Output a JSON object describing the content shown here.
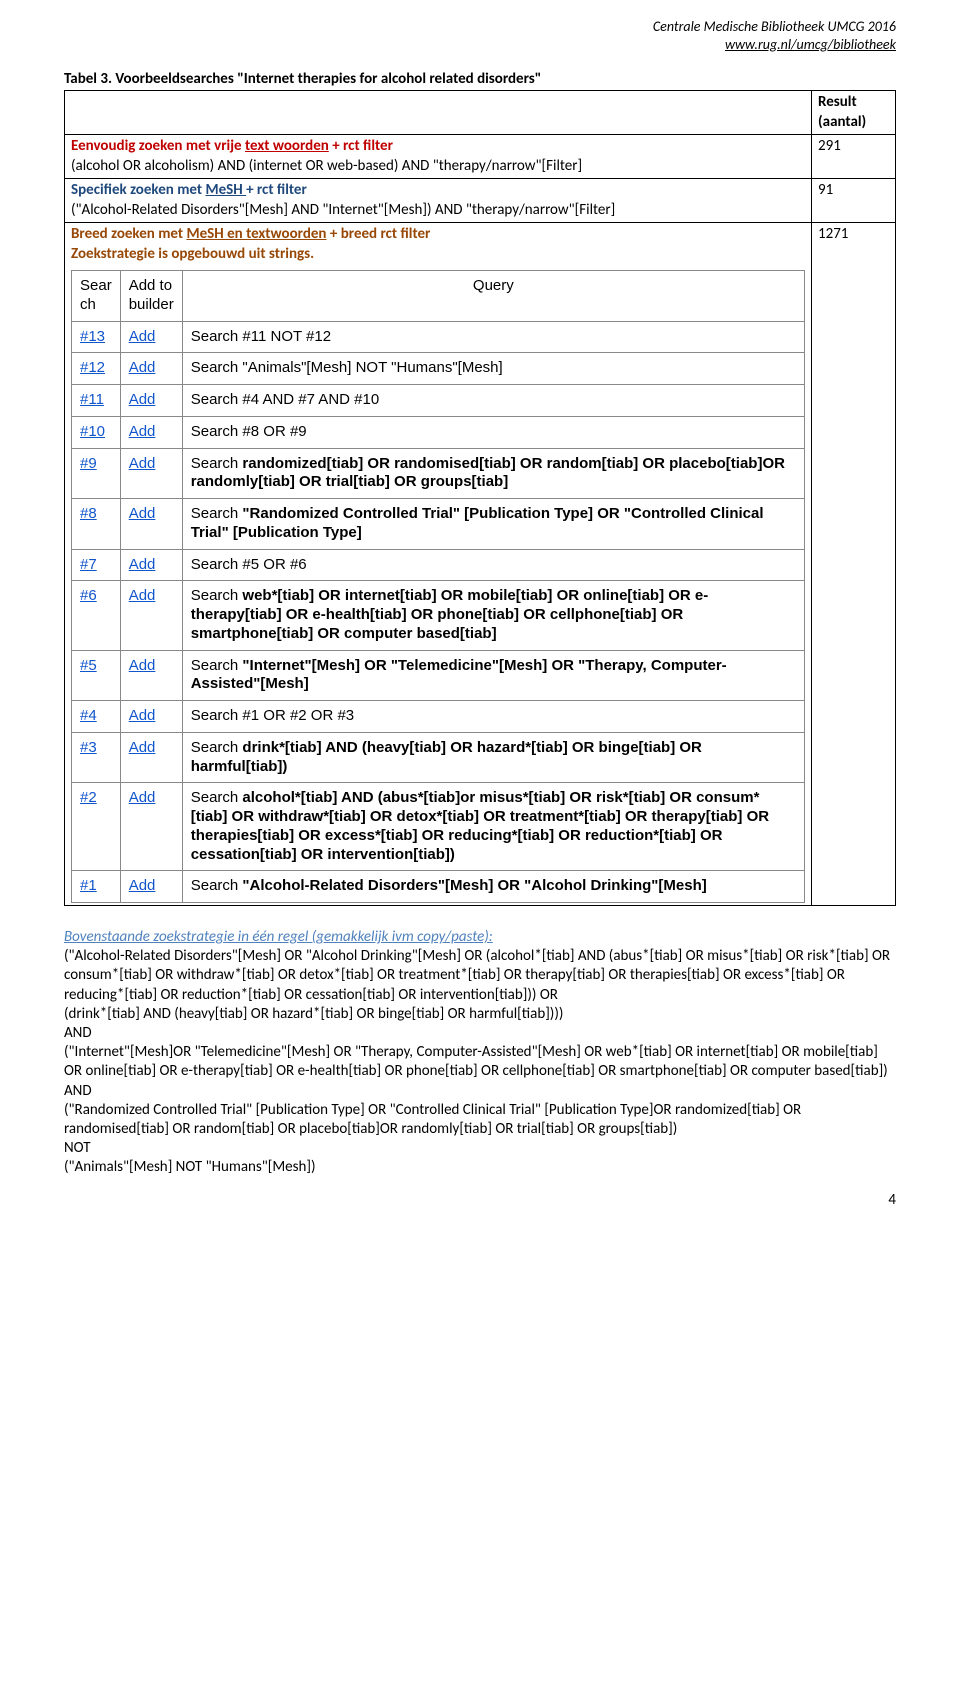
{
  "header": {
    "org": "Centrale Medische Bibliotheek UMCG 2016",
    "url": "www.rug.nl/umcg/bibliotheek"
  },
  "caption": "Tabel 3. Voorbeeldsearches \"Internet therapies  for alcohol related disorders\"",
  "thead": {
    "empty": "",
    "result": "Result (aantal)"
  },
  "rows": [
    {
      "title_plain": "Eenvoudig zoeken met vrije ",
      "title_ul": "text woorden",
      "title_rest": " +  rct filter",
      "body": "(alcohol OR alcoholism) AND (internet OR web-based) AND \"therapy/narrow\"[Filter]",
      "result": "291"
    },
    {
      "title_plain": "Specifiek zoeken met ",
      "title_ul": "MeSH ",
      "title_rest": " + rct filter",
      "body": "(\"Alcohol-Related Disorders\"[Mesh] AND \"Internet\"[Mesh]) AND \"therapy/narrow\"[Filter]",
      "result": "91"
    },
    {
      "title_plain": "Breed zoeken met ",
      "title_ul": "MeSH en textwoorden",
      "title_rest": " + breed rct filter",
      "subtitle": "Zoekstrategie is opgebouwd uit strings.",
      "result": "1271"
    }
  ],
  "inner_head": {
    "search": "Sear ch",
    "add": "Add to builder",
    "query": "Query"
  },
  "search_prefix": "Search ",
  "queries": [
    {
      "id": "#13",
      "add": "Add",
      "q": "#11 NOT #12"
    },
    {
      "id": "#12",
      "add": "Add",
      "q": "\"Animals\"[Mesh] NOT \"Humans\"[Mesh]"
    },
    {
      "id": "#11",
      "add": "Add",
      "q": "#4 AND #7 AND #10"
    },
    {
      "id": "#10",
      "add": "Add",
      "q": "#8 OR #9"
    },
    {
      "id": "#9",
      "add": "Add",
      "bold": "randomized[tiab] OR randomised[tiab] OR random[tiab] OR placebo[tiab]OR randomly[tiab] OR trial[tiab] OR groups[tiab]"
    },
    {
      "id": "#8",
      "add": "Add",
      "bold": "\"Randomized Controlled Trial\" [Publication Type] OR \"Controlled Clinical Trial\" [Publication Type]"
    },
    {
      "id": "#7",
      "add": "Add",
      "q": "#5 OR #6"
    },
    {
      "id": "#6",
      "add": "Add",
      "bold": "web*[tiab] OR internet[tiab] OR mobile[tiab] OR online[tiab] OR e-therapy[tiab] OR e-health[tiab] OR phone[tiab] OR cellphone[tiab] OR smartphone[tiab] OR computer based[tiab]"
    },
    {
      "id": "#5",
      "add": "Add",
      "bold": "\"Internet\"[Mesh] OR \"Telemedicine\"[Mesh] OR \"Therapy, Computer-Assisted\"[Mesh]"
    },
    {
      "id": "#4",
      "add": "Add",
      "q": "#1 OR #2 OR #3"
    },
    {
      "id": "#3",
      "add": "Add",
      "bold": "drink*[tiab] AND (heavy[tiab] OR hazard*[tiab] OR binge[tiab] OR harmful[tiab])"
    },
    {
      "id": "#2",
      "add": "Add",
      "bold": "alcohol*[tiab] AND (abus*[tiab]or misus*[tiab] OR risk*[tiab] OR consum*[tiab] OR withdraw*[tiab] OR detox*[tiab] OR treatment*[tiab] OR therapy[tiab] OR therapies[tiab] OR excess*[tiab] OR reducing*[tiab] OR reduction*[tiab] OR cessation[tiab] OR intervention[tiab])"
    },
    {
      "id": "#1",
      "add": "Add",
      "bold": "\"Alcohol-Related Disorders\"[Mesh] OR \"Alcohol Drinking\"[Mesh]"
    }
  ],
  "footer": {
    "title": "Bovenstaande zoekstrategie in één regel (gemakkelijk ivm copy/paste):",
    "lines": [
      "(\"Alcohol-Related Disorders\"[Mesh] OR \"Alcohol Drinking\"[Mesh] OR (alcohol*[tiab] AND (abus*[tiab] OR misus*[tiab] OR risk*[tiab] OR consum*[tiab] OR withdraw*[tiab] OR detox*[tiab] OR treatment*[tiab] OR therapy[tiab] OR therapies[tiab] OR excess*[tiab] OR reducing*[tiab] OR reduction*[tiab] OR cessation[tiab] OR intervention[tiab])) OR",
      "(drink*[tiab] AND (heavy[tiab] OR hazard*[tiab] OR binge[tiab] OR harmful[tiab])))",
      "AND",
      "(\"Internet\"[Mesh]OR \"Telemedicine\"[Mesh] OR \"Therapy, Computer-Assisted\"[Mesh] OR web*[tiab] OR internet[tiab] OR mobile[tiab] OR online[tiab] OR e-therapy[tiab] OR e-health[tiab] OR phone[tiab] OR cellphone[tiab] OR smartphone[tiab] OR computer based[tiab])",
      "AND",
      "(\"Randomized Controlled Trial\" [Publication Type] OR \"Controlled Clinical Trial\" [Publication Type]OR randomized[tiab] OR randomised[tiab] OR random[tiab] OR placebo[tiab]OR randomly[tiab] OR trial[tiab] OR groups[tiab])",
      "NOT",
      "(\"Animals\"[Mesh] NOT \"Humans\"[Mesh])"
    ]
  },
  "page_number": "4"
}
